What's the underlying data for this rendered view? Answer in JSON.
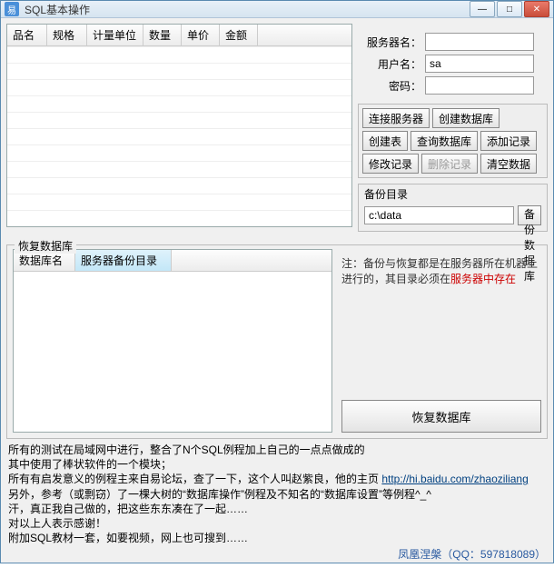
{
  "window": {
    "app_icon_text": "易",
    "title": "SQL基本操作"
  },
  "top_table": {
    "columns": [
      "品名",
      "规格",
      "计量单位",
      "数量",
      "单价",
      "金额",
      ""
    ]
  },
  "conn_form": {
    "server_label": "服务器名：",
    "server_value": "",
    "user_label": "用户名：",
    "user_value": "sa",
    "password_label": "密码：",
    "password_value": ""
  },
  "buttons_row1": [
    "连接服务器",
    "创建数据库",
    "创建表",
    "查询数据库"
  ],
  "buttons_row2": [
    {
      "label": "添加记录",
      "enabled": true
    },
    {
      "label": "修改记录",
      "enabled": true
    },
    {
      "label": "删除记录",
      "enabled": false
    },
    {
      "label": "清空数据",
      "enabled": true
    }
  ],
  "backup": {
    "legend": "备份目录",
    "path": "c:\\data",
    "button": "备份数据库"
  },
  "restore": {
    "legend": "恢复数据库",
    "columns": [
      "数据库名",
      "服务器备份目录",
      ""
    ],
    "note_prefix": "注：",
    "note_body1": "备份与恢复都是在服务器所在机器上进行的，其目录必须在",
    "note_body2": "服务器中存在",
    "button": "恢复数据库"
  },
  "footer": {
    "line1": "所有的测试在局域网中进行，整合了N个SQL例程加上自己的一点点做成的",
    "line2": "其中使用了棒状软件的一个模块；",
    "line3_a": "所有有启发意义的例程主来自易论坛，查了一下，这个人叫赵紫良，他的主页 ",
    "line3_url": "http://hi.baidu.com/zhaoziliang",
    "line4": "另外，参考（或剽窃）了一棵大树的“数据库操作”例程及不知名的“数据库设置”等例程^_^",
    "line5": "汗，真正我自己做的，把这些东东凑在了一起……",
    "line6": "对以上人表示感谢！",
    "line7": "附加SQL教材一套，如要视频，网上也可搜到……",
    "credit": "凤凰涅槃（QQ：597818089）"
  }
}
